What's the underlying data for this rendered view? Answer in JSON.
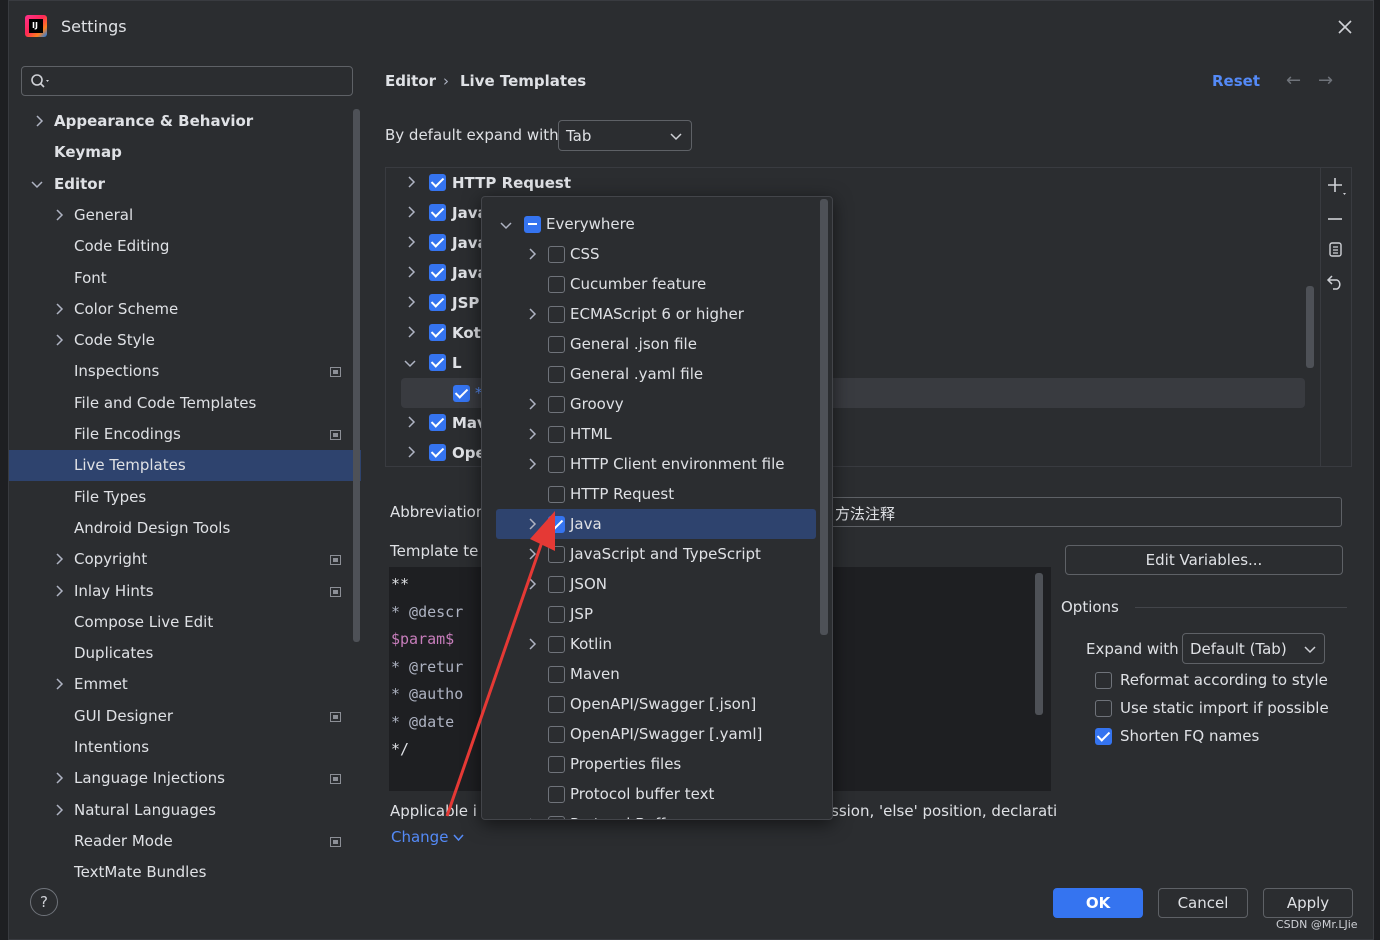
{
  "window": {
    "title": "Settings",
    "logo_text": "IJ"
  },
  "search": {
    "placeholder": ""
  },
  "sidebar": {
    "items": [
      {
        "label": "Appearance & Behavior",
        "level": 0,
        "expandable": true,
        "expanded": false,
        "bold": true
      },
      {
        "label": "Keymap",
        "level": 0,
        "expandable": false,
        "bold": true
      },
      {
        "label": "Editor",
        "level": 0,
        "expandable": true,
        "expanded": true,
        "bold": true
      },
      {
        "label": "General",
        "level": 1,
        "expandable": true
      },
      {
        "label": "Code Editing",
        "level": 1
      },
      {
        "label": "Font",
        "level": 1
      },
      {
        "label": "Color Scheme",
        "level": 1,
        "expandable": true
      },
      {
        "label": "Code Style",
        "level": 1,
        "expandable": true
      },
      {
        "label": "Inspections",
        "level": 1,
        "pinned": true
      },
      {
        "label": "File and Code Templates",
        "level": 1
      },
      {
        "label": "File Encodings",
        "level": 1,
        "pinned": true
      },
      {
        "label": "Live Templates",
        "level": 1,
        "selected": true
      },
      {
        "label": "File Types",
        "level": 1
      },
      {
        "label": "Android Design Tools",
        "level": 1
      },
      {
        "label": "Copyright",
        "level": 1,
        "expandable": true,
        "pinned": true
      },
      {
        "label": "Inlay Hints",
        "level": 1,
        "expandable": true,
        "pinned": true
      },
      {
        "label": "Compose Live Edit",
        "level": 1
      },
      {
        "label": "Duplicates",
        "level": 1
      },
      {
        "label": "Emmet",
        "level": 1,
        "expandable": true
      },
      {
        "label": "GUI Designer",
        "level": 1,
        "pinned": true
      },
      {
        "label": "Intentions",
        "level": 1
      },
      {
        "label": "Language Injections",
        "level": 1,
        "expandable": true,
        "pinned": true
      },
      {
        "label": "Natural Languages",
        "level": 1,
        "expandable": true
      },
      {
        "label": "Reader Mode",
        "level": 1,
        "pinned": true
      },
      {
        "label": "TextMate Bundles",
        "level": 1
      }
    ]
  },
  "header": {
    "breadcrumb": [
      "Editor",
      "Live Templates"
    ],
    "separator": "›",
    "reset_label": "Reset",
    "back_icon": "←",
    "forward_icon": "→"
  },
  "expand": {
    "label": "By default expand with",
    "value": "Tab"
  },
  "template_groups": [
    {
      "label": "HTTP Request",
      "checked": true,
      "expanded": false
    },
    {
      "label": "Java",
      "checked": true,
      "expanded": false
    },
    {
      "label": "Java",
      "checked": true,
      "expanded": false
    },
    {
      "label": "Java",
      "checked": true,
      "expanded": false
    },
    {
      "label": "JSP",
      "checked": true,
      "expanded": false
    },
    {
      "label": "Kotl",
      "checked": true,
      "expanded": false
    },
    {
      "label": "L",
      "checked": true,
      "expanded": true
    },
    {
      "label": "*",
      "checked": true,
      "child": true,
      "selected": true
    },
    {
      "label": "Mav",
      "checked": true,
      "expanded": false
    },
    {
      "label": "Ope",
      "checked": true,
      "expanded": false
    }
  ],
  "toolbar_icons": [
    "plus-icon",
    "minus-icon",
    "copy-icon",
    "revert-icon"
  ],
  "abbreviation": {
    "label": "Abbreviation",
    "value": "方法注释"
  },
  "template_text": {
    "label": "Template te",
    "lines": [
      "**",
      " * @descr",
      "$param$",
      " * @retur",
      " * @autho",
      " * @date",
      " */"
    ]
  },
  "applicable": {
    "label": "Applicable i",
    "tail": "ssion, 'else' position, declarati",
    "change_label": "Change"
  },
  "edit_variables_label": "Edit Variables...",
  "options": {
    "title": "Options",
    "expand_label": "Expand with",
    "expand_value": "Default (Tab)",
    "checkboxes": [
      {
        "label": "Reformat according to style",
        "checked": false
      },
      {
        "label": "Use static import if possible",
        "checked": false
      },
      {
        "label": "Shorten FQ names",
        "checked": true
      }
    ]
  },
  "popup": {
    "root": {
      "label": "Everywhere",
      "state": "indeterminate"
    },
    "items": [
      {
        "label": "CSS",
        "expandable": true,
        "checked": false
      },
      {
        "label": "Cucumber feature",
        "expandable": false,
        "checked": false
      },
      {
        "label": "ECMAScript 6 or higher",
        "expandable": true,
        "checked": false
      },
      {
        "label": "General .json file",
        "expandable": false,
        "checked": false
      },
      {
        "label": "General .yaml file",
        "expandable": false,
        "checked": false
      },
      {
        "label": "Groovy",
        "expandable": true,
        "checked": false
      },
      {
        "label": "HTML",
        "expandable": true,
        "checked": false
      },
      {
        "label": "HTTP Client environment file",
        "expandable": true,
        "checked": false
      },
      {
        "label": "HTTP Request",
        "expandable": false,
        "checked": false
      },
      {
        "label": "Java",
        "expandable": true,
        "checked": true,
        "selected": true
      },
      {
        "label": "JavaScript and TypeScript",
        "expandable": true,
        "checked": false
      },
      {
        "label": "JSON",
        "expandable": true,
        "checked": false
      },
      {
        "label": "JSP",
        "expandable": false,
        "checked": false
      },
      {
        "label": "Kotlin",
        "expandable": true,
        "checked": false
      },
      {
        "label": "Maven",
        "expandable": false,
        "checked": false
      },
      {
        "label": "OpenAPI/Swagger [.json]",
        "expandable": false,
        "checked": false
      },
      {
        "label": "OpenAPI/Swagger [.yaml]",
        "expandable": false,
        "checked": false
      },
      {
        "label": "Properties files",
        "expandable": false,
        "checked": false
      },
      {
        "label": "Protocol buffer text",
        "expandable": false,
        "checked": false
      },
      {
        "label": "Protocol Buffers",
        "expandable": true,
        "checked": false
      }
    ]
  },
  "buttons": {
    "help": "?",
    "ok": "OK",
    "cancel": "Cancel",
    "apply": "Apply"
  },
  "watermark": "CSDN @Mr.LJie",
  "colors": {
    "accent": "#3574f0",
    "selection": "#2e436e",
    "link": "#548af7",
    "param": "#c77dbb",
    "annotation_arrow": "#e53935"
  }
}
